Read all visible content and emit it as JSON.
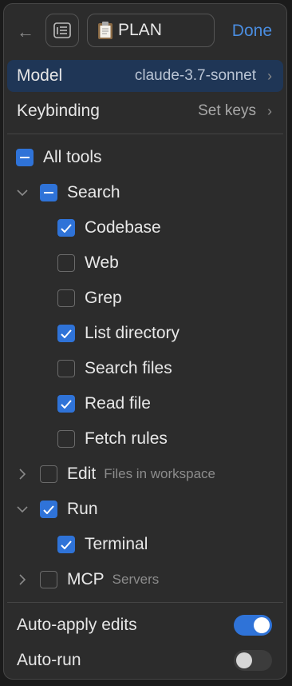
{
  "header": {
    "mode_name": "PLAN",
    "done_label": "Done"
  },
  "settings": [
    {
      "label": "Model",
      "value": "claude-3.7-sonnet"
    },
    {
      "label": "Keybinding",
      "value": "Set keys"
    }
  ],
  "tools": {
    "all_label": "All tools",
    "search": {
      "label": "Search",
      "items": [
        "Codebase",
        "Web",
        "Grep",
        "List directory",
        "Search files",
        "Read file",
        "Fetch rules"
      ]
    },
    "edit": {
      "label": "Edit",
      "sub": "Files in workspace"
    },
    "run": {
      "label": "Run",
      "items": [
        "Terminal"
      ]
    },
    "mcp": {
      "label": "MCP",
      "sub": "Servers"
    }
  },
  "options": [
    {
      "label": "Auto-apply edits",
      "state": "on"
    },
    {
      "label": "Auto-run",
      "state": "off"
    }
  ],
  "colors": {
    "accent": "#2f73d8",
    "selected_row": "#1f3656",
    "done": "#4a8de0"
  }
}
